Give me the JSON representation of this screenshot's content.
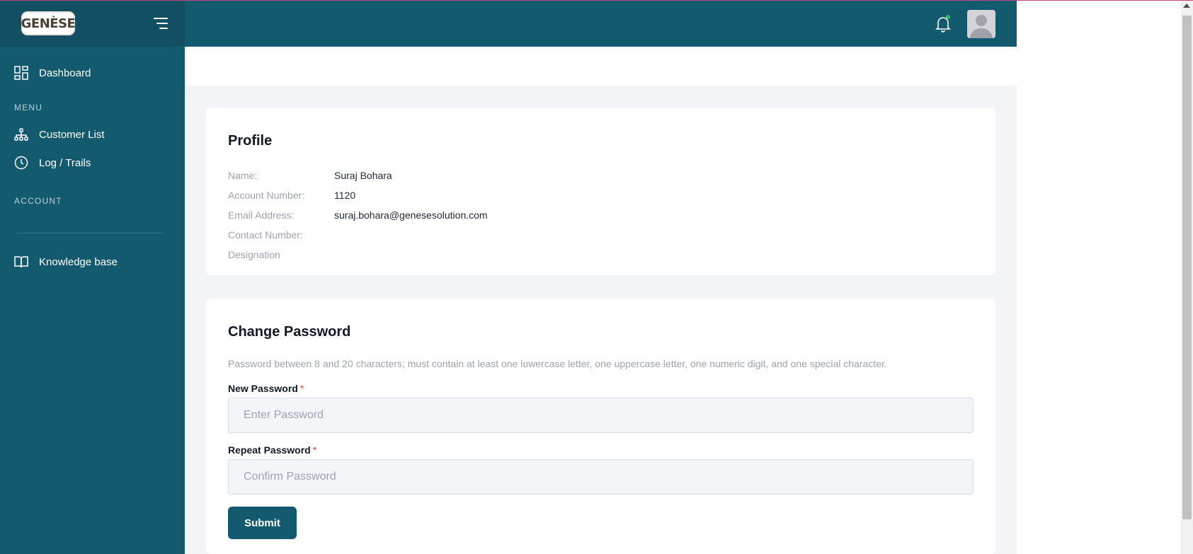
{
  "brand": {
    "logo_text": "GENÈSE"
  },
  "sidebar": {
    "dashboard_label": "Dashboard",
    "menu_heading": "MENU",
    "menu_items": [
      {
        "label": "Customer List",
        "icon": "sitemap-icon"
      },
      {
        "label": "Log / Trails",
        "icon": "clock-icon"
      }
    ],
    "account_heading": "ACCOUNT",
    "knowledge_label": "Knowledge base"
  },
  "header": {
    "notification_dot_color": "#22c55e"
  },
  "profile": {
    "title": "Profile",
    "rows": [
      {
        "label": "Name:",
        "value": "Suraj Bohara"
      },
      {
        "label": "Account Number:",
        "value": "1120"
      },
      {
        "label": "Email Address:",
        "value": "suraj.bohara@genesesolution.com"
      },
      {
        "label": "Contact Number:",
        "value": ""
      },
      {
        "label": "Designation",
        "value": ""
      }
    ]
  },
  "change_password": {
    "title": "Change Password",
    "hint": "Password between 8 and 20 characters; must contain at least one lowercase letter, one uppercase letter, one numeric digit, and one special character.",
    "new_label": "New Password",
    "new_placeholder": "Enter Password",
    "repeat_label": "Repeat Password",
    "repeat_placeholder": "Confirm Password",
    "required_mark": "*",
    "submit_label": "Submit"
  },
  "colors": {
    "sidebar": "#145a6e",
    "accent": "#145a6e",
    "required": "#ef4444"
  }
}
